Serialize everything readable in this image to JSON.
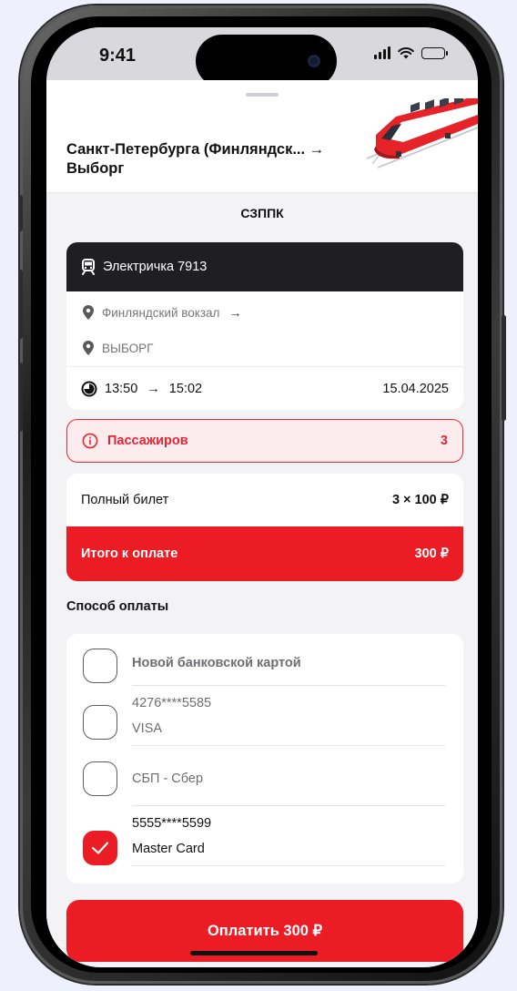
{
  "status_bar": {
    "time": "9:41"
  },
  "sheet": {
    "route_title": "Санкт-Петербурга (Финляндск... → Выборг",
    "carrier": "СЗППК"
  },
  "train": {
    "name": "Электричка 7913",
    "from_station": "Финляндский вокзал",
    "to_station": "ВЫБОРГ",
    "route_arrow": "→",
    "departure_time": "13:50",
    "arrival_time": "15:02",
    "time_arrow": "→",
    "date": "15.04.2025"
  },
  "passengers": {
    "label": "Пассажиров",
    "count": "3"
  },
  "pricing": {
    "full_ticket_label": "Полный билет",
    "full_ticket_value": "3 × 100 ₽",
    "total_label": "Итого к оплате",
    "total_value": "300 ₽"
  },
  "payment": {
    "section_title": "Способ оплаты",
    "methods": [
      {
        "line1": "Новой банковской картой",
        "checked": false
      },
      {
        "line1": "4276****5585",
        "line2": "VISA",
        "checked": false
      },
      {
        "line1": "СБП - Сбер",
        "checked": false
      },
      {
        "line1": "5555****5599",
        "line2": "Master Card",
        "checked": true
      }
    ]
  },
  "pay_button": {
    "label": "Оплатить 300 ₽"
  },
  "colors": {
    "accent": "#ec1c24",
    "header_dark": "#1f1f22",
    "background": "#f3f3f6",
    "warning_bg": "#fdecee"
  }
}
